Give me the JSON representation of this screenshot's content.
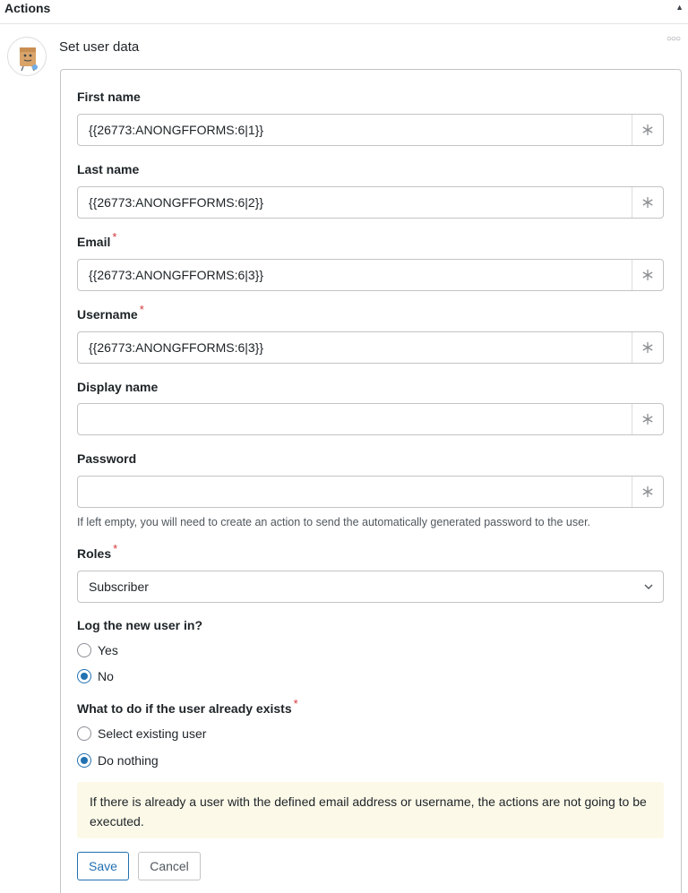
{
  "header": {
    "title": "Actions"
  },
  "action": {
    "title": "Set user data"
  },
  "fields": [
    {
      "label": "First name",
      "required": false,
      "value": "{{26773:ANONGFFORMS:6|1}}"
    },
    {
      "label": "Last name",
      "required": false,
      "value": "{{26773:ANONGFFORMS:6|2}}"
    },
    {
      "label": "Email",
      "required": true,
      "value": "{{26773:ANONGFFORMS:6|3}}"
    },
    {
      "label": "Username",
      "required": true,
      "value": "{{26773:ANONGFFORMS:6|3}}"
    },
    {
      "label": "Display name",
      "required": false,
      "value": ""
    },
    {
      "label": "Password",
      "required": false,
      "value": ""
    }
  ],
  "password_help": "If left empty, you will need to create an action to send the automatically generated password to the user.",
  "roles": {
    "label": "Roles",
    "required": true,
    "selected": "Subscriber"
  },
  "login": {
    "label": "Log the new user in?",
    "options": [
      {
        "label": "Yes",
        "checked": false
      },
      {
        "label": "No",
        "checked": true
      }
    ]
  },
  "exists": {
    "label": "What to do if the user already exists",
    "required": true,
    "options": [
      {
        "label": "Select existing user",
        "checked": false
      },
      {
        "label": "Do nothing",
        "checked": true
      }
    ]
  },
  "notice": "If there is already a user with the defined email address or username, the actions are not going to be executed.",
  "buttons": {
    "save": "Save",
    "cancel": "Cancel"
  },
  "icons": {
    "token": "asterisk-icon",
    "more": "more-dots-icon",
    "collapse": "caret-up-icon",
    "chevron": "chevron-down-icon"
  },
  "colors": {
    "accent": "#2271b1",
    "required": "#d63638",
    "notice_bg": "#fcf9e8"
  }
}
